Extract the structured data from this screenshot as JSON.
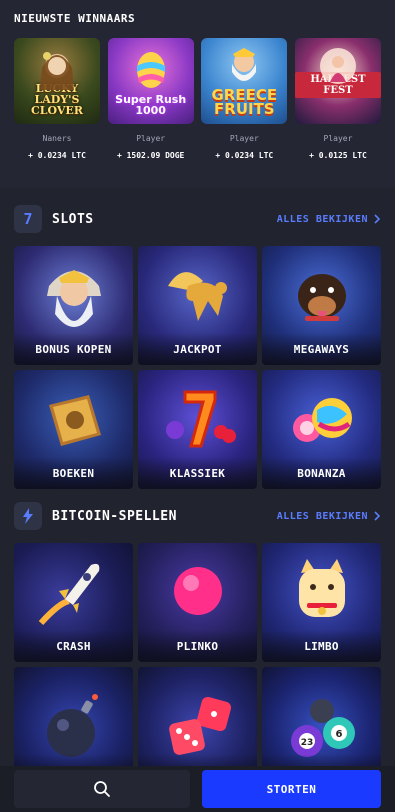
{
  "winners": {
    "title": "NIEUWSTE WINNAARS",
    "items": [
      {
        "game": "LUCKY LADY'S CLOVER",
        "player": "Naners",
        "amount": "+ 0.0234 LTC"
      },
      {
        "game": "Super Rush 1000",
        "player": "Player",
        "amount": "+ 1502.09 DOGE"
      },
      {
        "game": "GREECE FRUITS",
        "player": "Player",
        "amount": "+ 0.0234 LTC"
      },
      {
        "game": "HARVEST FEST",
        "player": "Player",
        "amount": "+ 0.0125 LTC"
      }
    ]
  },
  "slots": {
    "icon": "7",
    "title": "SLOTS",
    "see_all": "ALLES BEKIJKEN",
    "tiles": [
      "BONUS KOPEN",
      "JACKPOT",
      "MEGAWAYS",
      "BOEKEN",
      "KLASSIEK",
      "BONANZA"
    ]
  },
  "bitcoin": {
    "icon": "lightning-icon",
    "title": "BITCOIN-SPELLEN",
    "see_all": "ALLES BEKIJKEN",
    "tiles": [
      "CRASH",
      "PLINKO",
      "LIMBO",
      "",
      "",
      ""
    ],
    "bingo_balls": [
      "23",
      "6"
    ]
  },
  "bottom": {
    "search_icon": "search-icon",
    "deposit_label": "STORTEN"
  },
  "colors": {
    "accent": "#1a3bff",
    "link": "#5a7cff",
    "background": "#21232e"
  }
}
